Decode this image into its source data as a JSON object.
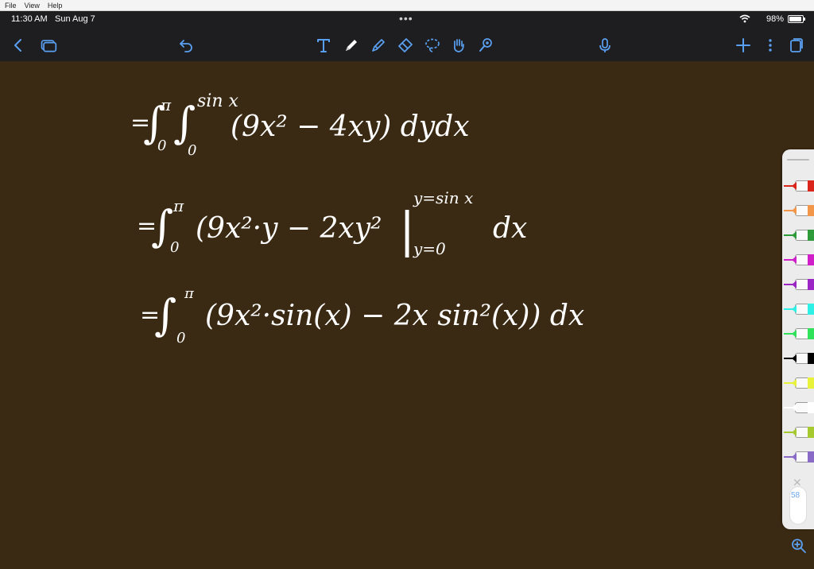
{
  "menubar": {
    "items": [
      "File",
      "View",
      "Help"
    ]
  },
  "status": {
    "time": "11:30 AM",
    "date": "Sun Aug 7",
    "battery": "98%",
    "more": "•••"
  },
  "toolbar": {
    "icons": [
      "back-icon",
      "pages-icon",
      "undo-icon",
      "text-tool-icon",
      "pen-tool-icon",
      "highlighter-icon",
      "eraser-icon",
      "lasso-icon",
      "hand-icon",
      "laser-pointer-icon",
      "microphone-icon",
      "add-icon",
      "more-icon",
      "page-view-icon"
    ],
    "accent": "#5aa0f2"
  },
  "math": {
    "line1": "=∫₀^π ∫₀^sin x (9x² − 4xy) dy dx",
    "line2": "=∫₀^π (9x²·y − 2xy² |_{y=0}^{y=sin x}) dx",
    "line3": "=∫₀^π (9x²·sin(x) − 2x sin²(x)) dx",
    "ink": "#ffffff"
  },
  "palette": {
    "colors": [
      "#d9251c",
      "#f2964a",
      "#2e9a3a",
      "#d01fc8",
      "#9b25c5",
      "#2ff0e4",
      "#2fe25a",
      "#000000",
      "#e8f23a",
      "#ffffff",
      "#a6c92f",
      "#8a6ac7"
    ],
    "count": "58"
  },
  "canvas": {
    "background": "#3b2a13"
  }
}
